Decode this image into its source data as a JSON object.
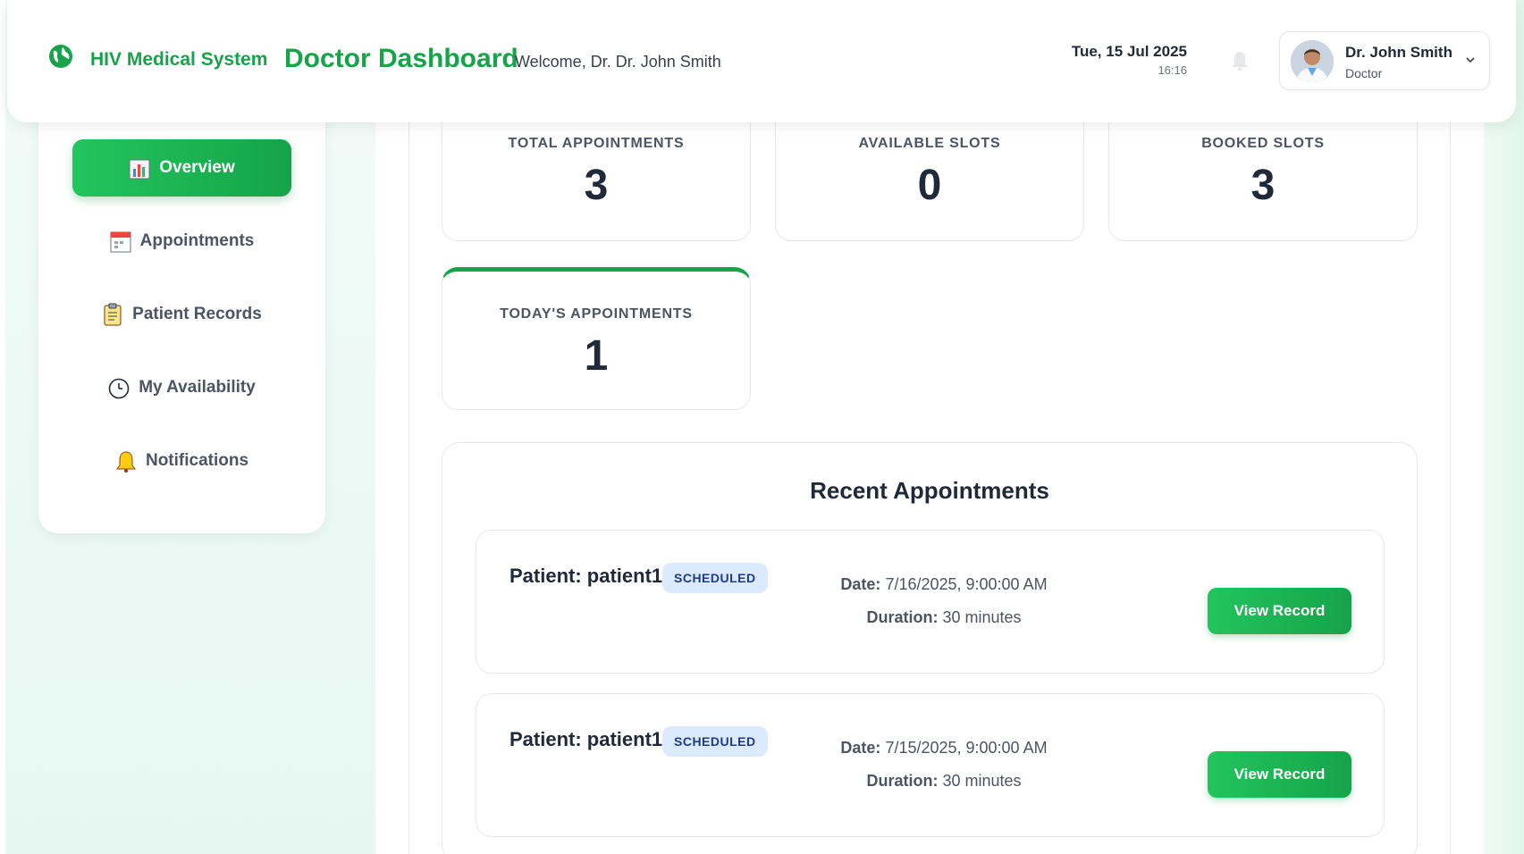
{
  "header": {
    "brand_name": "HIV Medical System",
    "title": "Doctor Dashboard",
    "welcome": "Welcome, Dr. Dr. John Smith",
    "date": "Tue, 15 Jul 2025",
    "time": "16:16",
    "user": {
      "name": "Dr. John Smith",
      "role": "Doctor"
    },
    "brand_color": "#16a34a",
    "icons": {
      "brand": "globe-icon",
      "notifications": "bell-icon",
      "user_menu": "chevron-down-icon"
    }
  },
  "sidebar": {
    "items": [
      {
        "label": "Overview",
        "icon": "bar-chart-icon",
        "active": true
      },
      {
        "label": "Appointments",
        "icon": "calendar-icon",
        "active": false
      },
      {
        "label": "Patient Records",
        "icon": "clipboard-icon",
        "active": false
      },
      {
        "label": "My Availability",
        "icon": "clock-icon",
        "active": false
      },
      {
        "label": "Notifications",
        "icon": "bell-icon",
        "active": false
      }
    ]
  },
  "stats": [
    {
      "label": "TOTAL APPOINTMENTS",
      "value": "3"
    },
    {
      "label": "AVAILABLE SLOTS",
      "value": "0"
    },
    {
      "label": "BOOKED SLOTS",
      "value": "3"
    },
    {
      "label": "TODAY'S APPOINTMENTS",
      "value": "1"
    }
  ],
  "recent": {
    "title": "Recent Appointments",
    "date_label": "Date:",
    "duration_label": "Duration:",
    "button_label": "View Record",
    "appointments": [
      {
        "patient": "Patient: patient1",
        "status": "SCHEDULED",
        "date": "7/16/2025, 9:00:00 AM",
        "duration": "30 minutes"
      },
      {
        "patient": "Patient: patient1",
        "status": "SCHEDULED",
        "date": "7/15/2025, 9:00:00 AM",
        "duration": "30 minutes"
      }
    ]
  }
}
